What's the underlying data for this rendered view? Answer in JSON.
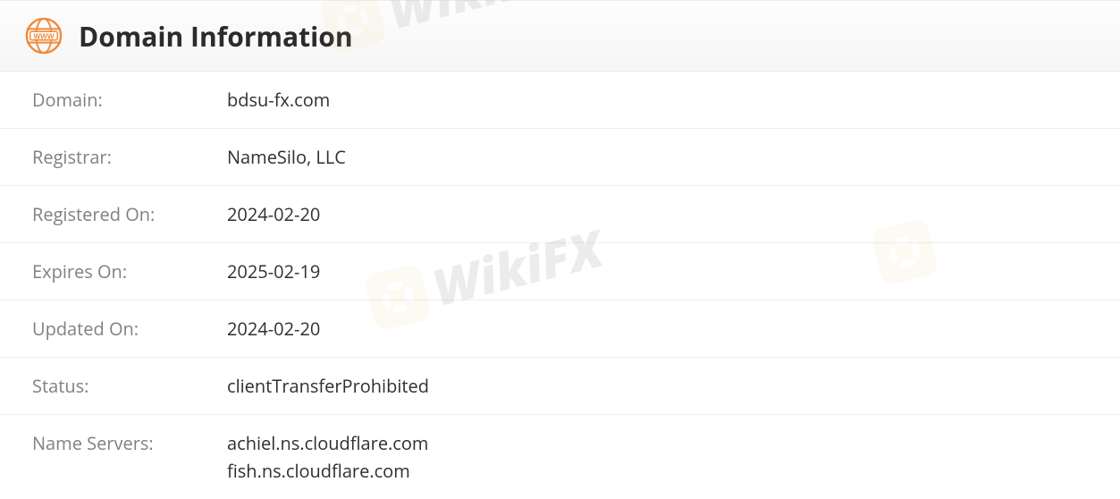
{
  "header": {
    "title": "Domain Information",
    "icon_label": "www"
  },
  "rows": [
    {
      "label": "Domain:",
      "value": "bdsu-fx.com"
    },
    {
      "label": "Registrar:",
      "value": "NameSilo, LLC"
    },
    {
      "label": "Registered On:",
      "value": "2024-02-20"
    },
    {
      "label": "Expires On:",
      "value": "2025-02-19"
    },
    {
      "label": "Updated On:",
      "value": "2024-02-20"
    },
    {
      "label": "Status:",
      "value": "clientTransferProhibited"
    },
    {
      "label": "Name Servers:",
      "value": "achiel.ns.cloudflare.com\nfish.ns.cloudflare.com"
    }
  ],
  "watermark": {
    "text": "WikiFX"
  }
}
